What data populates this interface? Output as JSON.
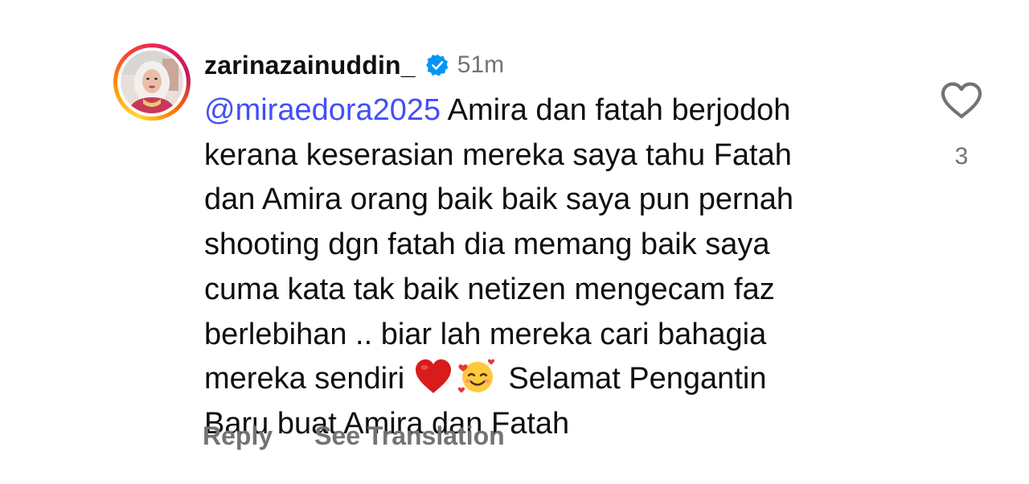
{
  "comment": {
    "username": "zarinazainuddin_",
    "time": "51m",
    "mention": "@miraedora2025",
    "lines": [
      " Amira dan fatah berjodoh",
      "kerana keserasian mereka saya tahu Fatah",
      "dan Amira orang baik baik saya pun pernah",
      "shooting dgn fatah dia memang baik saya",
      "cuma kata tak baik netizen mengecam faz",
      "berlebihan .. biar lah mereka cari bahagia"
    ],
    "line7_start": "mereka sendiri",
    "line7_end": "Selamat Pengantin",
    "line8": "Baru buat Amira dan Fatah",
    "emojis": [
      "red-heart",
      "smiling-face-with-hearts"
    ]
  },
  "actions": {
    "reply_label": "Reply",
    "translate_label": "See Translation"
  },
  "like": {
    "count": "3"
  },
  "colors": {
    "mention": "#4150f7",
    "secondary_text": "#737373",
    "verified": "#0095f6"
  }
}
